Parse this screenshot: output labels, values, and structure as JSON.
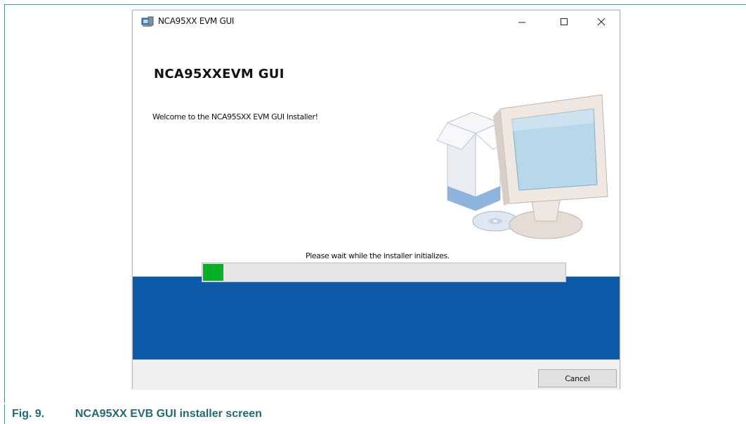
{
  "window": {
    "title": "NCA95XX EVM GUI",
    "controls": {
      "minimize_icon": "minimize-icon",
      "maximize_icon": "maximize-icon",
      "close_icon": "close-icon"
    }
  },
  "installer": {
    "heading": "NCA95XXEVM GUI",
    "welcome_text": "Welcome to the NCA95SXX EVM GUI Installer!",
    "status_text": "Please wait while the installer initializes.",
    "progress_fraction": 0.06,
    "cancel_label": "Cancel"
  },
  "colors": {
    "band_blue": "#0f5aa8",
    "progress_green": "#06b025",
    "caption_teal": "#1f6a73"
  },
  "caption": {
    "number": "Fig. 9.",
    "text": "NCA95XX EVB GUI installer screen"
  }
}
